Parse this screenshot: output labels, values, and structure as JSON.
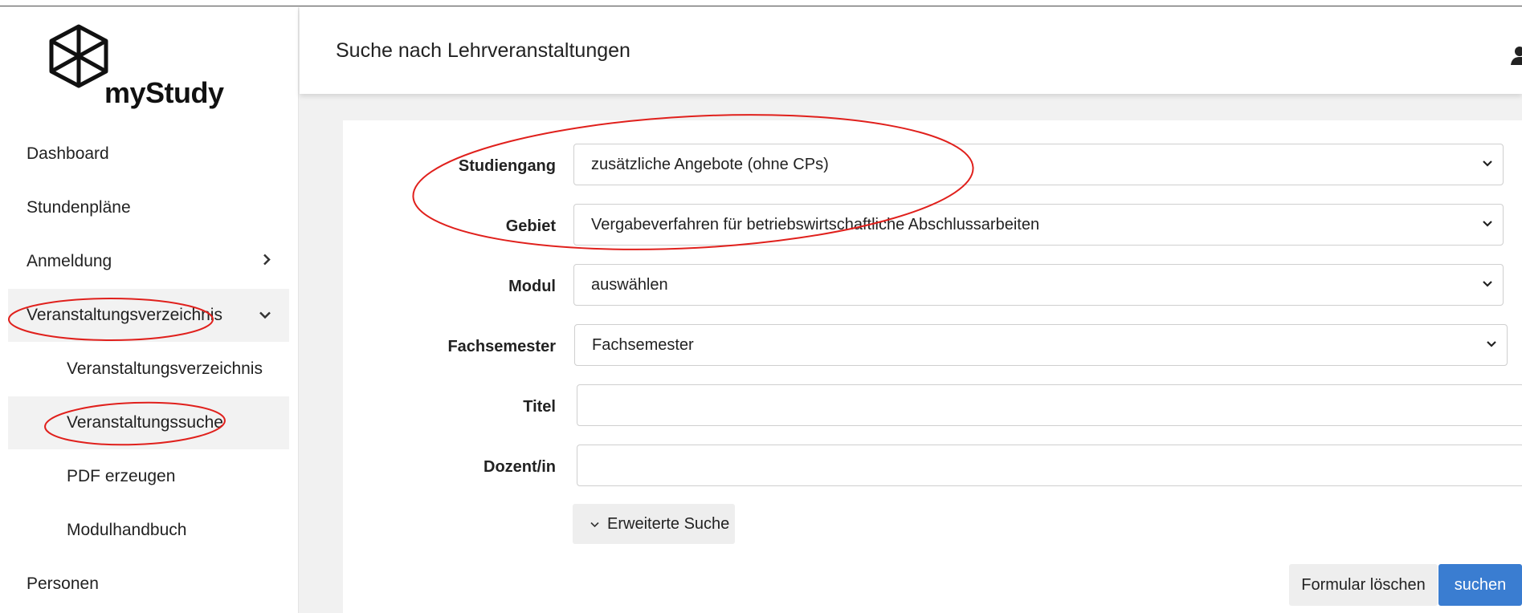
{
  "app": {
    "name": "myStudy"
  },
  "header": {
    "title": "Suche nach Lehrveranstaltungen"
  },
  "sidebar": {
    "items": [
      {
        "label": "Dashboard"
      },
      {
        "label": "Stundenpläne"
      },
      {
        "label": "Anmeldung"
      },
      {
        "label": "Veranstaltungsverzeichnis"
      },
      {
        "label": "Veranstaltungsverzeichnis"
      },
      {
        "label": "Veranstaltungssuche"
      },
      {
        "label": "PDF erzeugen"
      },
      {
        "label": "Modulhandbuch"
      },
      {
        "label": "Personen"
      }
    ]
  },
  "form": {
    "studiengang": {
      "label": "Studiengang",
      "value": "zusätzliche Angebote (ohne CPs)"
    },
    "gebiet": {
      "label": "Gebiet",
      "value": "Vergabeverfahren für betriebswirtschaftliche Abschlussarbeiten"
    },
    "modul": {
      "label": "Modul",
      "value": "auswählen"
    },
    "fachsemester": {
      "label": "Fachsemester",
      "value": "Fachsemester"
    },
    "titel": {
      "label": "Titel",
      "value": ""
    },
    "dozent": {
      "label": "Dozent/in",
      "value": ""
    },
    "extended_search_label": "Erweiterte Suche",
    "clear_label": "Formular löschen",
    "search_label": "suchen"
  },
  "colors": {
    "primary": "#3a7dd1",
    "annotation": "#e0201c",
    "active_bg": "#f2f2f2"
  },
  "icons": {
    "logo": "hexagon-cube-icon",
    "user": "user-icon",
    "chevron_right": "chevron-right-icon",
    "chevron_down": "chevron-down-icon"
  }
}
